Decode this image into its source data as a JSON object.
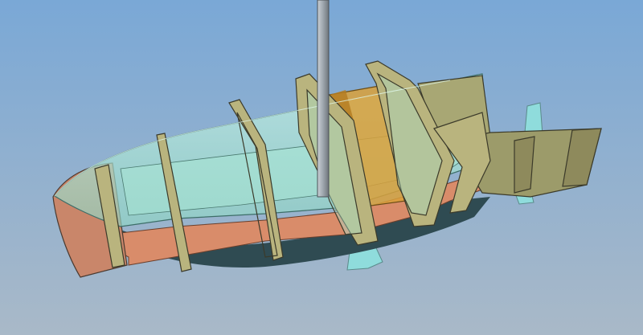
{
  "viewport": {
    "background_top": "#7aa8d6",
    "background_bottom": "#a9b9c8"
  },
  "model": {
    "hull_glass_color": "#9fe0d0",
    "hull_bottom_color": "#2f4b52",
    "hull_side_color": "#d98c6a",
    "frame_color": "#b9b47e",
    "frame_edge_color": "#3b3a2a",
    "tank_color": "#d9a03a",
    "fin_color": "#8fdcdc",
    "mast_color": "#9ea6ad",
    "deck_color": "#a8a774"
  }
}
